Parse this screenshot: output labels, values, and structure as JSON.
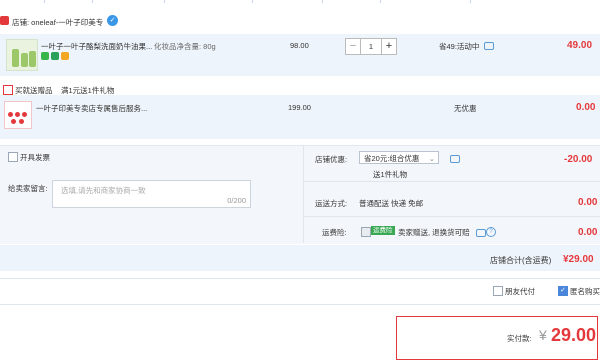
{
  "shop": {
    "label": "店铺: oneleaf-一叶子印美专"
  },
  "item": {
    "title": "一叶子一叶子酪梨洗面奶牛油果...",
    "sku": "化妆品净含量: 80g",
    "price": "98.00",
    "qty": "1",
    "promo": "省49:活动中",
    "total": "49.00"
  },
  "gift": {
    "header_label": "买就送赠品",
    "header_desc": "满1元送1件礼物",
    "title": "一叶子印美专卖店专属售后服务...",
    "price": "199.00",
    "promo": "无优惠",
    "total": "0.00"
  },
  "invoice": {
    "label": "开具发票"
  },
  "message": {
    "label": "给卖家留言:",
    "placeholder": "选填,请先和商家协商一致",
    "counter": "0/200"
  },
  "shop_discount": {
    "label": "店铺优惠:",
    "selected": "省20元:组合优惠",
    "note": "送1件礼物",
    "amount": "-20.00"
  },
  "shipping": {
    "label": "运送方式:",
    "value": "普通配送 快递 免邮",
    "amount": "0.00"
  },
  "insurance": {
    "label": "运费险:",
    "tag": "运费险",
    "desc": "卖家赠送, 退换货可赔",
    "amount": "0.00"
  },
  "store_total": {
    "label": "店铺合计(含运费)",
    "amount": "¥29.00"
  },
  "options": {
    "friend_pay": "朋友代付",
    "anon_buy": "匿名购买"
  },
  "payment": {
    "label": "实付款:",
    "currency": "¥",
    "amount": "29.00"
  }
}
